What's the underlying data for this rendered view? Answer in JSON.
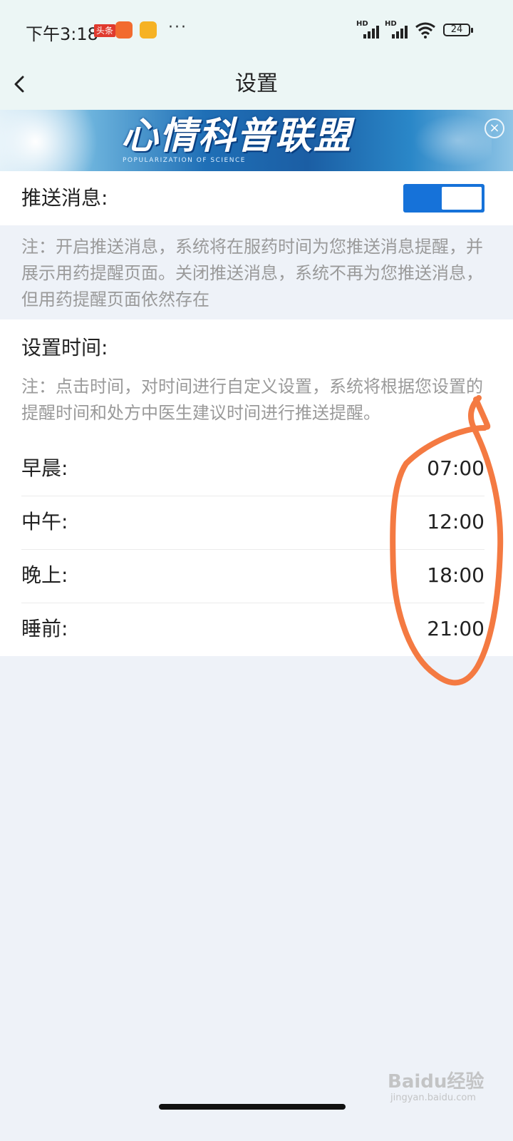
{
  "status_bar": {
    "time": "下午3:18",
    "toutiao_badge": "头条",
    "more": "···",
    "signal_1_label": "HD",
    "signal_2_label": "HD",
    "battery_level": "24"
  },
  "header": {
    "title": "设置"
  },
  "banner": {
    "title": "心情科普联盟",
    "subtitle": "POPULARIZATION OF SCIENCE"
  },
  "push": {
    "label": "推送消息:",
    "enabled": true,
    "note": "注：开启推送消息，系统将在服药时间为您推送消息提醒，并展示用药提醒页面。关闭推送消息，系统不再为您推送消息，但用药提醒页面依然存在"
  },
  "time_settings": {
    "heading": "设置时间:",
    "note": "注：点击时间，对时间进行自定义设置，系统将根据您设置的提醒时间和处方中医生建议时间进行推送提醒。",
    "rows": [
      {
        "label": "早晨:",
        "time": "07:00"
      },
      {
        "label": "中午:",
        "time": "12:00"
      },
      {
        "label": "晚上:",
        "time": "18:00"
      },
      {
        "label": "睡前:",
        "time": "21:00"
      }
    ]
  },
  "colors": {
    "accent": "#1672d9",
    "annotation": "#f47a42",
    "background": "#eef2f8",
    "header_bg": "#ecf6f5"
  },
  "watermark": {
    "brand": "Baidu经验",
    "url": "jingyan.baidu.com"
  }
}
